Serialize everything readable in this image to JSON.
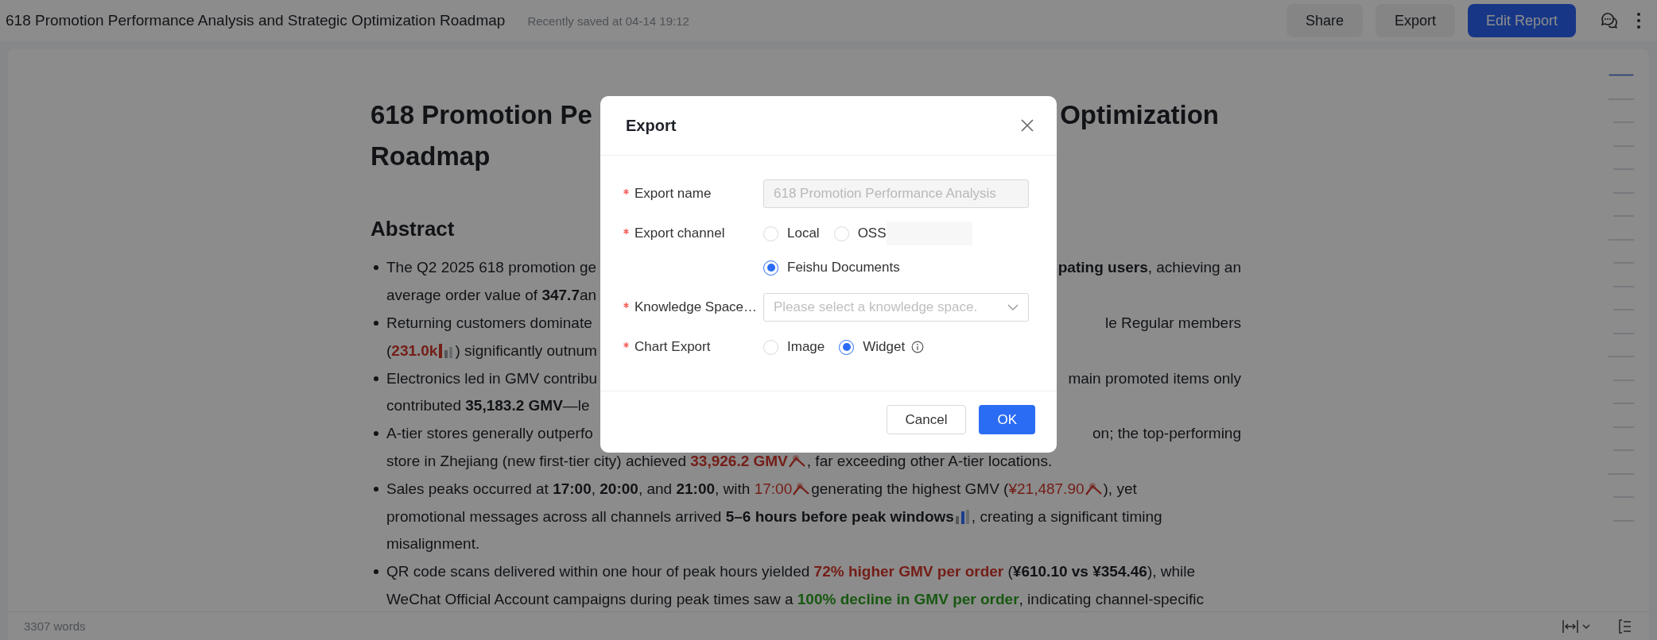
{
  "top_bar": {
    "title": "618 Promotion Performance Analysis and Strategic Optimization Roadmap",
    "saved_status": "Recently saved at 04-14 19:12",
    "buttons": [
      {
        "label": "Share",
        "kind": "plain"
      },
      {
        "label": "Export",
        "kind": "plain"
      },
      {
        "label": "Edit Report",
        "kind": "primary"
      }
    ]
  },
  "document": {
    "title_lines": [
      {
        "left": "618 Promotion Pe",
        "right": "Optimization"
      },
      {
        "left": "Roadmap"
      }
    ],
    "heading": "Abstract",
    "bullets": [
      {
        "lines": [
          {
            "left": [
              {
                "text": "The Q2 2025 618 promotion ge"
              }
            ],
            "right": [
              {
                "text": "**pating users**, achieving an"
              }
            ]
          },
          {
            "left": [
              {
                "text": "average order value of **347.7**an"
              }
            ]
          }
        ]
      },
      {
        "lines": [
          {
            "left": [
              {
                "text": "Returning customers dominate"
              }
            ],
            "right": [
              {
                "text": "le Regular members"
              }
            ]
          },
          {
            "left": [
              {
                "text": "("
              },
              {
                "text": "231.0k",
                "kind": "alert",
                "bold": true
              },
              {
                "kind": "bars"
              },
              {
                "text": ") significantly outnum"
              }
            ]
          }
        ]
      },
      {
        "lines": [
          {
            "left": [
              {
                "text": "Electronics led in GMV contribu"
              }
            ],
            "right": [
              {
                "text": "main promoted items only"
              }
            ]
          },
          {
            "left": [
              {
                "text": "contributed **35,183.2 GMV**—le"
              }
            ]
          }
        ]
      },
      {
        "lines": [
          {
            "left": [
              {
                "text": "A-tier stores generally outperfo"
              }
            ],
            "right": [
              {
                "text": "on; the top-performing"
              }
            ]
          },
          {
            "left": [
              {
                "text": "store in Zhejiang (new first-tier city) achieved "
              },
              {
                "text": "33,926.2 GMV",
                "kind": "alert",
                "bold": true
              },
              {
                "kind": "trend"
              },
              {
                "text": ", far exceeding other A-tier locations."
              }
            ]
          }
        ]
      },
      {
        "lines": [
          {
            "left": [
              {
                "text": "Sales peaks occurred at **17:00**, **20:00**, and **21:00**, with "
              },
              {
                "text": "17:00",
                "kind": "alert",
                "bold": false
              },
              {
                "kind": "trend"
              },
              {
                "text": "generating the highest GMV ("
              },
              {
                "text": "¥21,487.90",
                "kind": "alert",
                "bold": false
              },
              {
                "kind": "trend"
              },
              {
                "text": "), yet"
              }
            ]
          },
          {
            "left": [
              {
                "text": "promotional messages across all channels arrived **5–6 hours before peak windows**"
              },
              {
                "kind": "bars-alt"
              },
              {
                "text": ", creating a significant timing"
              }
            ]
          },
          {
            "left": [
              {
                "text": "misalignment."
              }
            ]
          }
        ]
      },
      {
        "lines": [
          {
            "left": [
              {
                "text": "QR code scans delivered within one hour of peak hours yielded "
              },
              {
                "text": "72% higher GMV per order",
                "kind": "alert",
                "bold": true
              },
              {
                "text": " (**¥610.10 vs ¥354.46**), while"
              }
            ]
          },
          {
            "left": [
              {
                "text": "WeChat Official Account campaigns during peak times saw a "
              },
              {
                "text": "100% decline in GMV per order",
                "kind": "positive",
                "bold": true
              },
              {
                "text": ", indicating channel-specific"
              }
            ]
          }
        ]
      }
    ]
  },
  "outline": [
    {
      "selected": true
    },
    {
      "selected": false,
      "children": [
        {
          "selected": false
        },
        {
          "selected": false
        },
        {
          "selected": false
        },
        {
          "selected": false
        },
        {
          "selected": false
        }
      ]
    },
    {
      "selected": false,
      "children": [
        {
          "selected": false
        },
        {
          "selected": false
        },
        {
          "selected": false
        },
        {
          "selected": false
        }
      ]
    },
    {
      "selected": false,
      "children": [
        {
          "selected": false
        },
        {
          "selected": false
        },
        {
          "selected": false
        },
        {
          "selected": false
        }
      ]
    },
    {
      "selected": false,
      "children": [
        {
          "selected": false
        },
        {
          "selected": false
        }
      ]
    }
  ],
  "status_bar": {
    "word_count": "3307 words"
  },
  "dialog": {
    "title": "Export",
    "fields": [
      {
        "label": "Export name",
        "required": true,
        "kind": "input",
        "value": "618 Promotion Performance Analysis",
        "disabled": true
      },
      {
        "label": "Export channel",
        "required": true,
        "kind": "radio",
        "options": [
          {
            "label": "Local",
            "selected": false
          },
          {
            "label": "OSS",
            "selected": false,
            "masked_suffix": true
          },
          {
            "label": "Feishu Documents",
            "selected": true
          }
        ]
      },
      {
        "label": "Knowledge Space…",
        "required": true,
        "kind": "select",
        "placeholder": "Please select a knowledge space."
      },
      {
        "label": "Chart Export",
        "required": true,
        "kind": "radio",
        "options": [
          {
            "label": "Image",
            "selected": false
          },
          {
            "label": "Widget",
            "selected": true,
            "info": true
          }
        ]
      }
    ],
    "buttons": [
      {
        "label": "Cancel",
        "kind": "plain"
      },
      {
        "label": "OK",
        "kind": "primary"
      }
    ]
  }
}
